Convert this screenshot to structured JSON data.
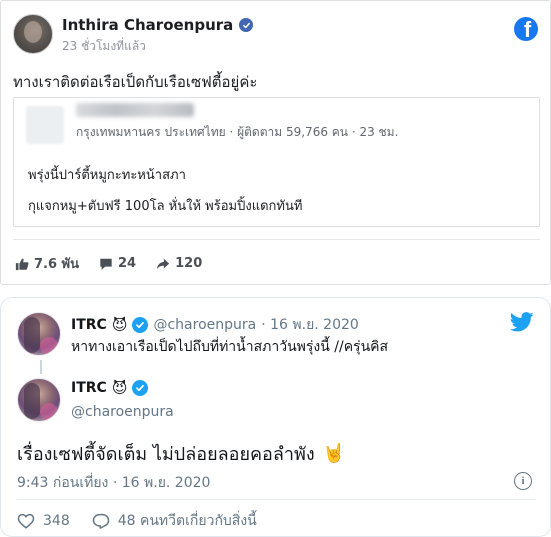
{
  "facebook": {
    "author_name": "Inthira Charoenpura",
    "time": "23 ชั่วโมงที่แล้ว",
    "post_text": "ทางเราติดต่อเรือเป็ดกับเรือเซฟตี้อยู่ค่ะ",
    "shared": {
      "meta": "กรุงเทพมหานคร ประเทศไทย · ผู้ติดตาม 59,766 คน · 23 ชม.",
      "line1": "พรุ่งนี้ปาร์ตี้หมูกะทะหน้าสภา",
      "line2": "กุแจกหมู+ตับฟรี 100โล หั่นให้ พร้อมปิ้งแดกทันที"
    },
    "likes": "7.6 พัน",
    "comments": "24",
    "shares": "120",
    "icons": [
      "verified-badge-icon",
      "facebook-logo-icon",
      "like-icon",
      "comment-icon",
      "share-icon"
    ],
    "colors": {
      "brand": "#1877f2",
      "verified": "#4267b2"
    }
  },
  "twitter": {
    "quoted": {
      "name": "ITRC",
      "emoji": "😈",
      "handle": "@charoenpura",
      "date": "· 16 พ.ย. 2020",
      "text": "หาทางเอาเรือเป็ดไปถึบที่ท่าน้ำสภาวันพรุ่งนี้ //ครุ่นคิส"
    },
    "main": {
      "name": "ITRC",
      "emoji": "😈",
      "handle": "@charoenpura",
      "text": "เรื่องเซฟตี้จัดเต็ม ไม่ปล่อยลอยคอลำพัง",
      "text_emoji": "🤘",
      "timestamp": "9:43 ก่อนเที่ยง · 16 พ.ย. 2020",
      "info_label": "i",
      "likes": "348",
      "replies_label": "48 คนทวีตเกี่ยวกับสิ่งนี้"
    },
    "icons": [
      "twitter-logo-icon",
      "verified-badge-icon",
      "heart-icon",
      "reply-icon",
      "info-icon"
    ],
    "colors": {
      "brand": "#1da1f2"
    }
  }
}
